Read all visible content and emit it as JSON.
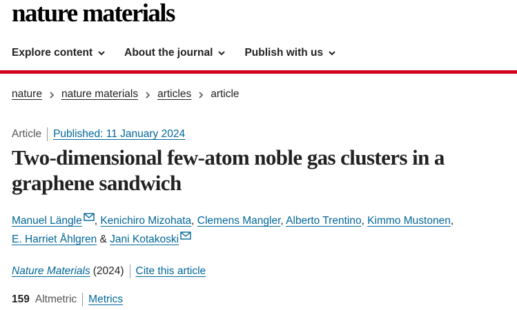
{
  "site": {
    "logo": "nature materials"
  },
  "nav": {
    "items": [
      {
        "label": "Explore content"
      },
      {
        "label": "About the journal"
      },
      {
        "label": "Publish with us"
      }
    ]
  },
  "breadcrumb": {
    "items": [
      "nature",
      "nature materials",
      "articles"
    ],
    "current": "article"
  },
  "article": {
    "type": "Article",
    "published": "Published: 11 January 2024",
    "title": "Two-dimensional few-atom noble gas clusters in a graphene sandwich",
    "authors": [
      "Manuel Längle",
      "Kenichiro Mizohata",
      "Clemens Mangler",
      "Alberto Trentino",
      "Kimmo Mustonen",
      "E. Harriet Åhlgren",
      "Jani Kotakoski"
    ],
    "journal": "Nature Materials",
    "year": "(2024)",
    "cite_label": "Cite this article",
    "altmetric_count": "159",
    "altmetric_label": "Altmetric",
    "metrics_label": "Metrics"
  },
  "colors": {
    "accent_red": "#d0021b",
    "link_blue": "#006699"
  },
  "icons": [
    "chevron-down-icon",
    "chevron-right-icon",
    "mail-icon"
  ]
}
